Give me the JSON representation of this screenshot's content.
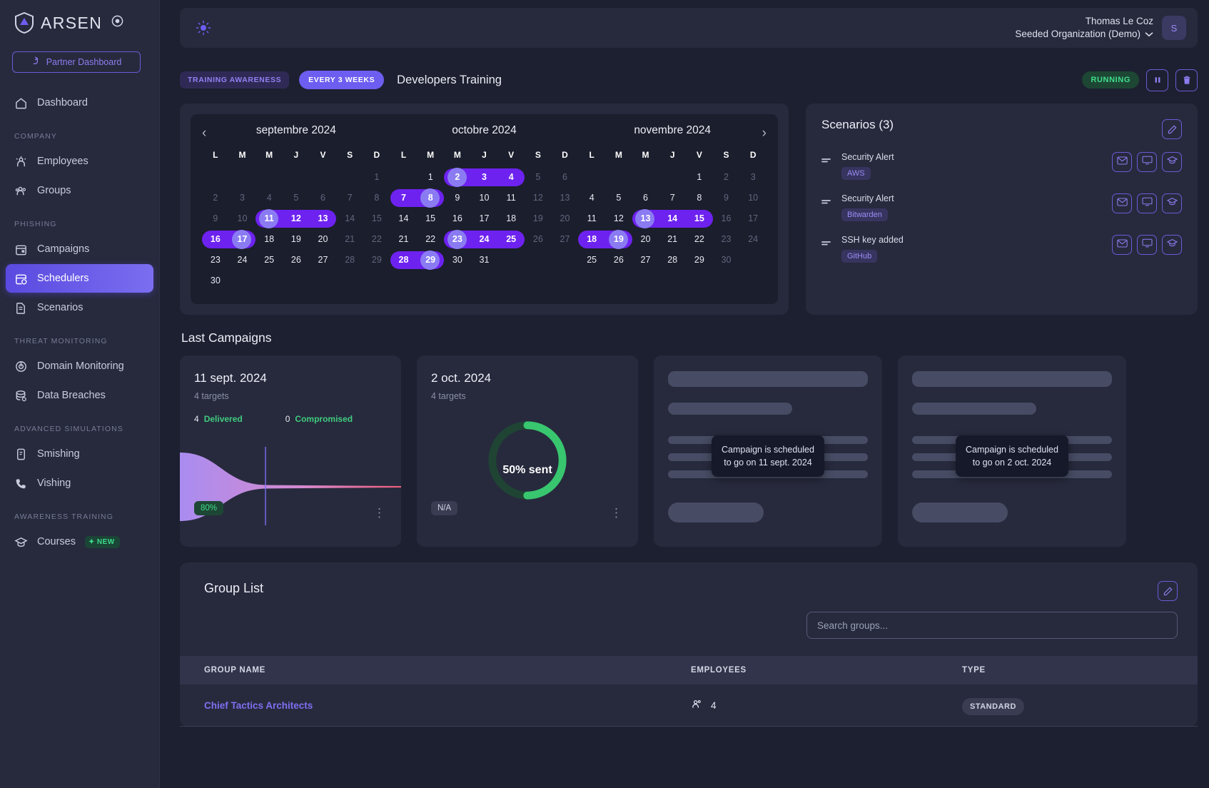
{
  "brand": {
    "name": "ARSEN"
  },
  "sidebar": {
    "partner_button": "Partner Dashboard",
    "items": [
      {
        "label": "Dashboard",
        "icon": "home-icon",
        "active": false
      },
      {
        "label": "Employees",
        "icon": "employees-icon",
        "active": false
      },
      {
        "label": "Groups",
        "icon": "groups-icon",
        "active": false
      },
      {
        "label": "Campaigns",
        "icon": "calendar-icon",
        "active": false
      },
      {
        "label": "Schedulers",
        "icon": "scheduler-icon",
        "active": true
      },
      {
        "label": "Scenarios",
        "icon": "document-icon",
        "active": false
      },
      {
        "label": "Domain Monitoring",
        "icon": "radar-icon",
        "active": false
      },
      {
        "label": "Data Breaches",
        "icon": "database-icon",
        "active": false
      },
      {
        "label": "Smishing",
        "icon": "phone-message-icon",
        "active": false
      },
      {
        "label": "Vishing",
        "icon": "phone-icon",
        "active": false
      },
      {
        "label": "Courses",
        "icon": "graduation-cap-icon",
        "active": false,
        "badge": "NEW"
      }
    ],
    "sections": {
      "company": "COMPANY",
      "phishing": "PHISHING",
      "threat": "THREAT MONITORING",
      "advanced": "ADVANCED SIMULATIONS",
      "awareness": "AWARENESS TRAINING"
    }
  },
  "topbar": {
    "user_name": "Thomas Le Coz",
    "organization": "Seeded Organization (Demo)",
    "avatar_initial": "S"
  },
  "scheduler": {
    "tag_category": "TRAINING AWARENESS",
    "tag_frequency": "EVERY 3 WEEKS",
    "title": "Developers Training",
    "status": "RUNNING",
    "pause_label": "pause-icon",
    "delete_label": "trash-icon"
  },
  "calendar": {
    "prev_label": "‹",
    "next_label": "›",
    "dow": [
      "L",
      "M",
      "M",
      "J",
      "V",
      "S",
      "D"
    ],
    "months": [
      {
        "title": "septembre 2024",
        "weeks": [
          [
            null,
            null,
            null,
            null,
            null,
            null,
            {
              "d": 1,
              "dim": true
            }
          ],
          [
            {
              "d": 2,
              "dim": true
            },
            {
              "d": 3,
              "dim": true
            },
            {
              "d": 4,
              "dim": true
            },
            {
              "d": 5,
              "dim": true
            },
            {
              "d": 6,
              "dim": true
            },
            {
              "d": 7,
              "dim": true
            },
            {
              "d": 8,
              "dim": true
            }
          ],
          [
            {
              "d": 9,
              "dim": true
            },
            {
              "d": 10,
              "dim": true
            },
            {
              "d": 11,
              "sel": true,
              "circle": true
            },
            {
              "d": 12,
              "sel": true
            },
            {
              "d": 13,
              "sel": true
            },
            {
              "d": 14,
              "dim": true
            },
            {
              "d": 15,
              "dim": true
            }
          ],
          [
            {
              "d": 16,
              "sel": true
            },
            {
              "d": 17,
              "sel": true,
              "circle": true
            },
            {
              "d": 18
            },
            {
              "d": 19
            },
            {
              "d": 20
            },
            {
              "d": 21,
              "dim": true
            },
            {
              "d": 22,
              "dim": true
            }
          ],
          [
            {
              "d": 23
            },
            {
              "d": 24
            },
            {
              "d": 25
            },
            {
              "d": 26
            },
            {
              "d": 27
            },
            {
              "d": 28,
              "dim": true
            },
            {
              "d": 29,
              "dim": true
            }
          ],
          [
            {
              "d": 30
            },
            null,
            null,
            null,
            null,
            null,
            null
          ]
        ],
        "highlights": [
          {
            "week": 2,
            "start": 2,
            "end": 4
          },
          {
            "week": 3,
            "start": 0,
            "end": 1
          }
        ],
        "circles": [
          {
            "week": 2,
            "col": 2
          },
          {
            "week": 3,
            "col": 1
          }
        ]
      },
      {
        "title": "octobre 2024",
        "weeks": [
          [
            null,
            {
              "d": 1
            },
            {
              "d": 2,
              "sel": true,
              "circle": true
            },
            {
              "d": 3,
              "sel": true
            },
            {
              "d": 4,
              "sel": true
            },
            {
              "d": 5,
              "dim": true
            },
            {
              "d": 6,
              "dim": true
            }
          ],
          [
            {
              "d": 7,
              "sel": true
            },
            {
              "d": 8,
              "sel": true,
              "circle": true
            },
            {
              "d": 9
            },
            {
              "d": 10
            },
            {
              "d": 11
            },
            {
              "d": 12,
              "dim": true
            },
            {
              "d": 13,
              "dim": true
            }
          ],
          [
            {
              "d": 14
            },
            {
              "d": 15
            },
            {
              "d": 16
            },
            {
              "d": 17
            },
            {
              "d": 18
            },
            {
              "d": 19,
              "dim": true
            },
            {
              "d": 20,
              "dim": true
            }
          ],
          [
            {
              "d": 21
            },
            {
              "d": 22
            },
            {
              "d": 23,
              "sel": true,
              "circle": true
            },
            {
              "d": 24,
              "sel": true
            },
            {
              "d": 25,
              "sel": true
            },
            {
              "d": 26,
              "dim": true
            },
            {
              "d": 27,
              "dim": true
            }
          ],
          [
            {
              "d": 28,
              "sel": true
            },
            {
              "d": 29,
              "sel": true,
              "circle": true
            },
            {
              "d": 30
            },
            {
              "d": 31
            },
            null,
            null,
            null
          ]
        ],
        "highlights": [
          {
            "week": 0,
            "start": 2,
            "end": 4
          },
          {
            "week": 1,
            "start": 0,
            "end": 1
          },
          {
            "week": 3,
            "start": 2,
            "end": 4
          },
          {
            "week": 4,
            "start": 0,
            "end": 1
          }
        ],
        "circles": [
          {
            "week": 0,
            "col": 2
          },
          {
            "week": 1,
            "col": 1
          },
          {
            "week": 3,
            "col": 2
          },
          {
            "week": 4,
            "col": 1
          }
        ]
      },
      {
        "title": "novembre 2024",
        "weeks": [
          [
            null,
            null,
            null,
            null,
            {
              "d": 1
            },
            {
              "d": 2,
              "dim": true
            },
            {
              "d": 3,
              "dim": true
            }
          ],
          [
            {
              "d": 4
            },
            {
              "d": 5
            },
            {
              "d": 6
            },
            {
              "d": 7
            },
            {
              "d": 8
            },
            {
              "d": 9,
              "dim": true
            },
            {
              "d": 10,
              "dim": true
            }
          ],
          [
            {
              "d": 11
            },
            {
              "d": 12
            },
            {
              "d": 13,
              "sel": true,
              "circle": true
            },
            {
              "d": 14,
              "sel": true
            },
            {
              "d": 15,
              "sel": true
            },
            {
              "d": 16,
              "dim": true
            },
            {
              "d": 17,
              "dim": true
            }
          ],
          [
            {
              "d": 18,
              "sel": true
            },
            {
              "d": 19,
              "sel": true,
              "circle": true
            },
            {
              "d": 20
            },
            {
              "d": 21
            },
            {
              "d": 22
            },
            {
              "d": 23,
              "dim": true
            },
            {
              "d": 24,
              "dim": true
            }
          ],
          [
            {
              "d": 25
            },
            {
              "d": 26
            },
            {
              "d": 27
            },
            {
              "d": 28
            },
            {
              "d": 29
            },
            {
              "d": 30,
              "dim": true
            },
            null
          ]
        ],
        "highlights": [
          {
            "week": 2,
            "start": 2,
            "end": 4
          },
          {
            "week": 3,
            "start": 0,
            "end": 1
          }
        ],
        "circles": [
          {
            "week": 2,
            "col": 2
          },
          {
            "week": 3,
            "col": 1
          }
        ]
      }
    ]
  },
  "scenarios": {
    "title": "Scenarios (3)",
    "items": [
      {
        "name": "Security Alert",
        "tag": "AWS"
      },
      {
        "name": "Security Alert",
        "tag": "Bitwarden"
      },
      {
        "name": "SSH key added",
        "tag": "GitHub"
      }
    ],
    "action_icons": [
      "envelope-icon",
      "monitor-icon",
      "graduation-cap-icon"
    ]
  },
  "last_campaigns": {
    "title": "Last Campaigns",
    "cards": [
      {
        "type": "funnel",
        "date": "11 sept. 2024",
        "targets": "4 targets",
        "delivered_count": "4",
        "delivered_label": "Delivered",
        "compromised_count": "0",
        "compromised_label": "Compromised",
        "badge": "80%"
      },
      {
        "type": "donut",
        "date": "2 oct. 2024",
        "targets": "4 targets",
        "donut_label": "50% sent",
        "donut_percent": 50,
        "badge": "N/A"
      },
      {
        "type": "skeleton",
        "tooltip": "Campaign is scheduled\nto go on 11 sept. 2024"
      },
      {
        "type": "skeleton",
        "tooltip": "Campaign is scheduled\nto go on 2 oct. 2024"
      }
    ]
  },
  "group_list": {
    "title": "Group List",
    "search_placeholder": "Search groups...",
    "columns": [
      "GROUP NAME",
      "EMPLOYEES",
      "TYPE"
    ],
    "rows": [
      {
        "name": "Chief Tactics Architects",
        "employees": "4",
        "type": "STANDARD"
      }
    ]
  },
  "colors": {
    "accent": "#6d5df0",
    "highlight": "#6d22f0",
    "circle": "#8a7bf3",
    "success": "#40dd8c",
    "panel": "#272a3d",
    "bg": "#1d2030"
  }
}
